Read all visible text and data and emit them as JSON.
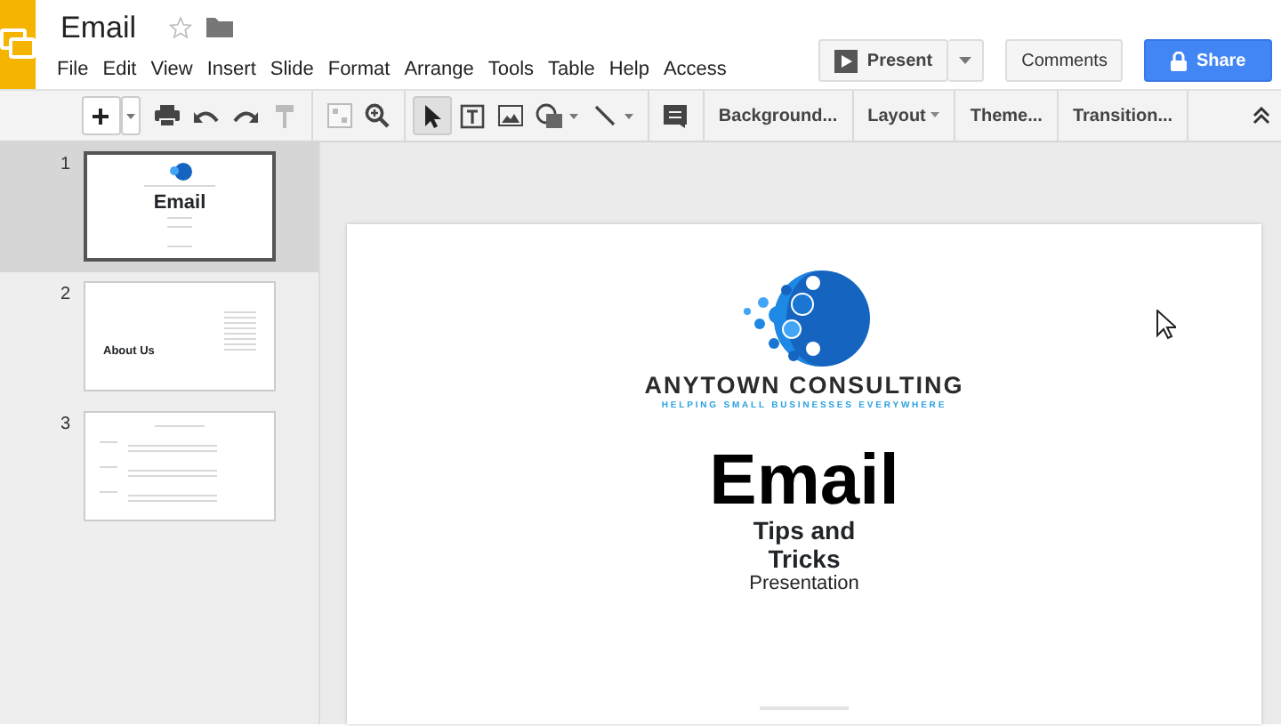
{
  "document": {
    "title": "Email",
    "starred": false
  },
  "menu": [
    "File",
    "Edit",
    "View",
    "Insert",
    "Slide",
    "Format",
    "Arrange",
    "Tools",
    "Table",
    "Help",
    "Access"
  ],
  "header_buttons": {
    "present": "Present",
    "comments": "Comments",
    "share": "Share"
  },
  "toolbar": {
    "text_buttons": [
      {
        "label": "Background...",
        "dropdown": false
      },
      {
        "label": "Layout",
        "dropdown": true
      },
      {
        "label": "Theme...",
        "dropdown": false
      },
      {
        "label": "Transition...",
        "dropdown": false
      }
    ]
  },
  "slides": [
    {
      "number": "1",
      "selected": true,
      "kind": "title",
      "title": "Email"
    },
    {
      "number": "2",
      "selected": false,
      "kind": "about",
      "title": "About Us"
    },
    {
      "number": "3",
      "selected": false,
      "kind": "list"
    }
  ],
  "slide": {
    "company": "ANYTOWN CONSULTING",
    "tagline": "HELPING SMALL BUSINESSES EVERYWHERE",
    "title": "Email",
    "subtitle_lines": [
      "Tips and",
      "Tricks"
    ],
    "caption": "Presentation"
  }
}
